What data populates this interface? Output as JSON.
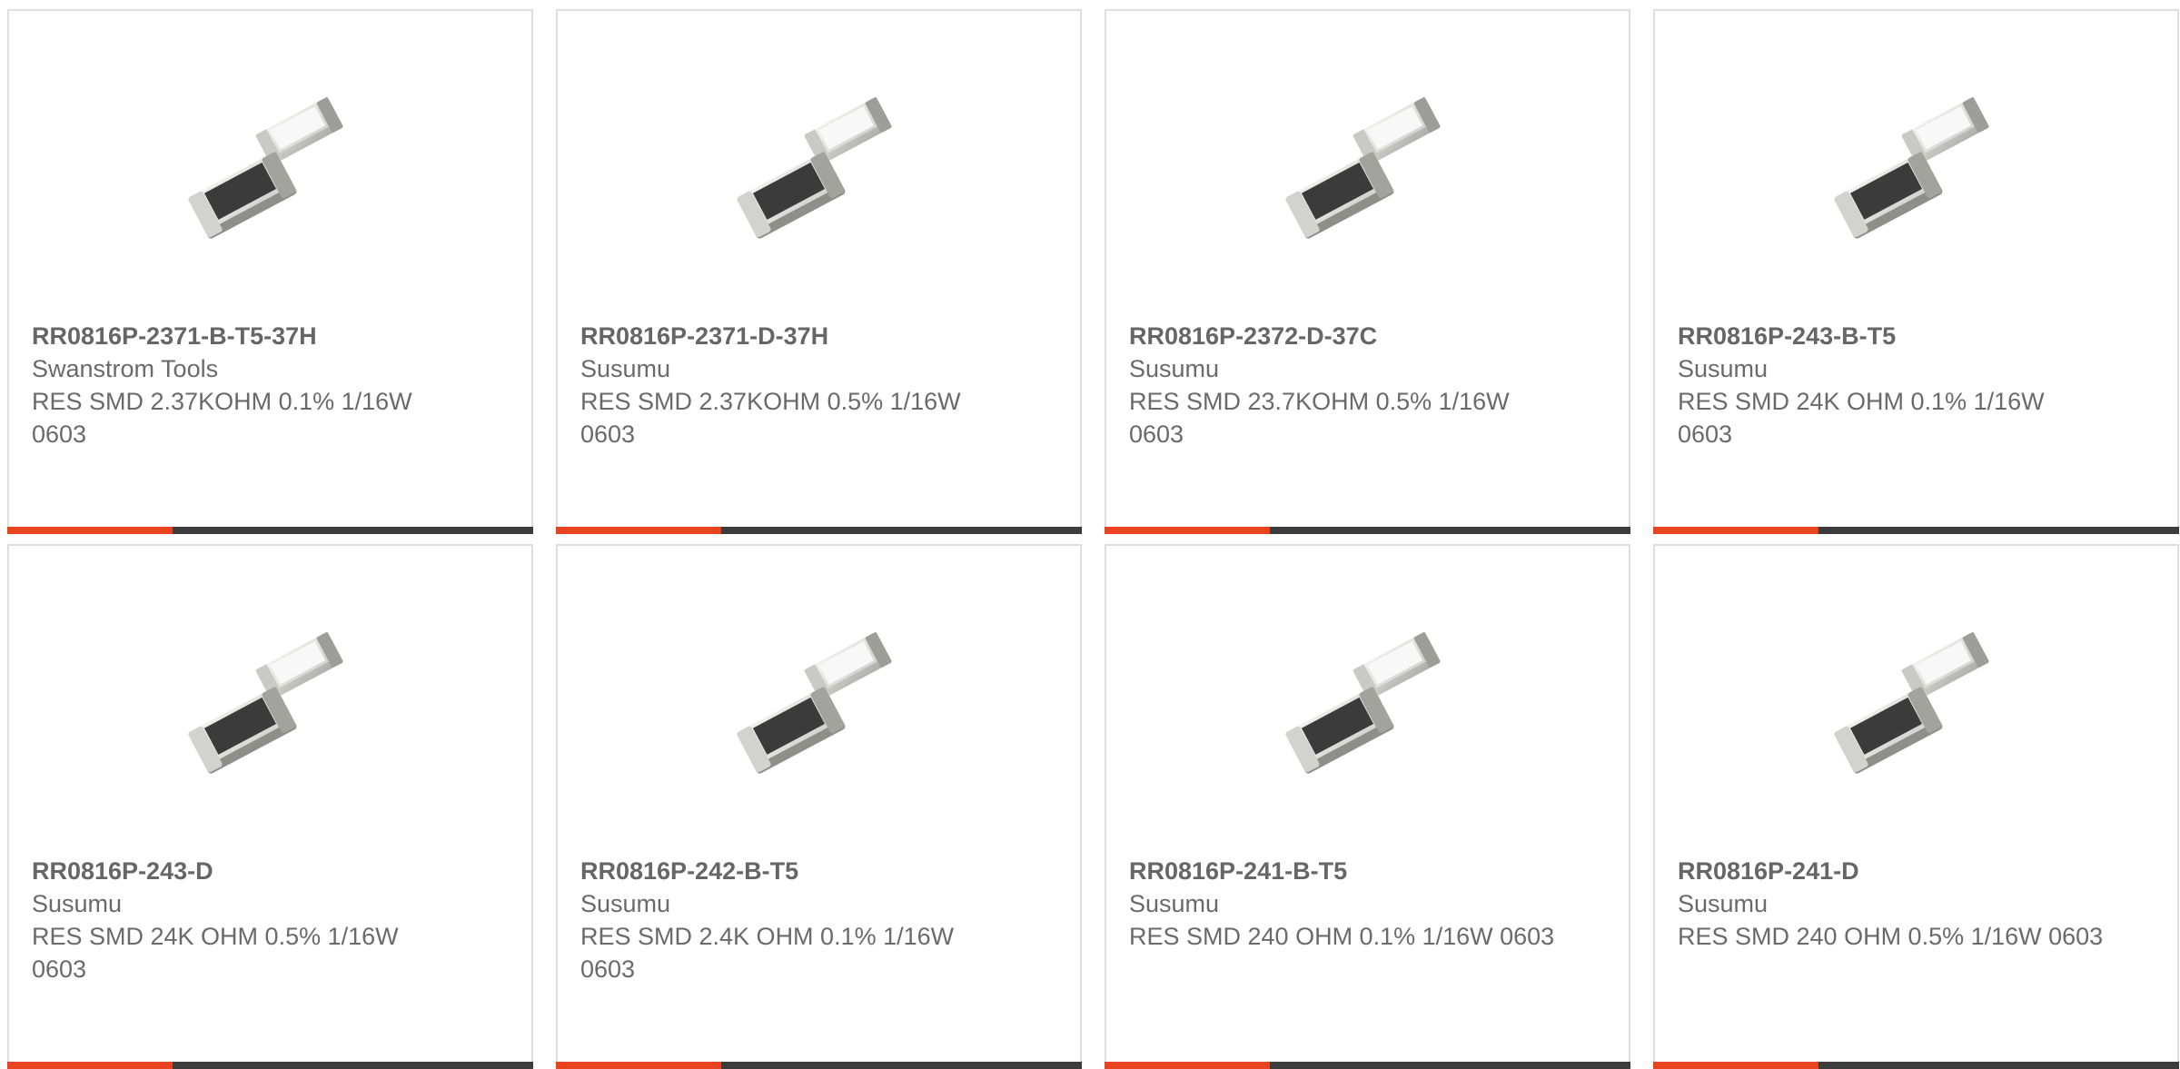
{
  "colors": {
    "accent": "#e84420",
    "bar": "#3c3c3c",
    "border": "#dedede",
    "text": "#6a6a6a"
  },
  "products": [
    {
      "part_number": "RR0816P-2371-B-T5-37H",
      "manufacturer": "Swanstrom Tools",
      "description": "RES SMD 2.37KOHM 0.1% 1/16W 0603",
      "image_icon": "smd-resistor-image"
    },
    {
      "part_number": "RR0816P-2371-D-37H",
      "manufacturer": "Susumu",
      "description": "RES SMD 2.37KOHM 0.5% 1/16W 0603",
      "image_icon": "smd-resistor-image"
    },
    {
      "part_number": "RR0816P-2372-D-37C",
      "manufacturer": "Susumu",
      "description": "RES SMD 23.7KOHM 0.5% 1/16W 0603",
      "image_icon": "smd-resistor-image"
    },
    {
      "part_number": "RR0816P-243-B-T5",
      "manufacturer": "Susumu",
      "description": "RES SMD 24K OHM 0.1% 1/16W 0603",
      "image_icon": "smd-resistor-image"
    },
    {
      "part_number": "RR0816P-243-D",
      "manufacturer": "Susumu",
      "description": "RES SMD 24K OHM 0.5% 1/16W 0603",
      "image_icon": "smd-resistor-image"
    },
    {
      "part_number": "RR0816P-242-B-T5",
      "manufacturer": "Susumu",
      "description": "RES SMD 2.4K OHM 0.1% 1/16W 0603",
      "image_icon": "smd-resistor-image"
    },
    {
      "part_number": "RR0816P-241-B-T5",
      "manufacturer": "Susumu",
      "description": "RES SMD 240 OHM 0.1% 1/16W 0603",
      "image_icon": "smd-resistor-image"
    },
    {
      "part_number": "RR0816P-241-D",
      "manufacturer": "Susumu",
      "description": "RES SMD 240 OHM 0.5% 1/16W 0603",
      "image_icon": "smd-resistor-image"
    }
  ]
}
